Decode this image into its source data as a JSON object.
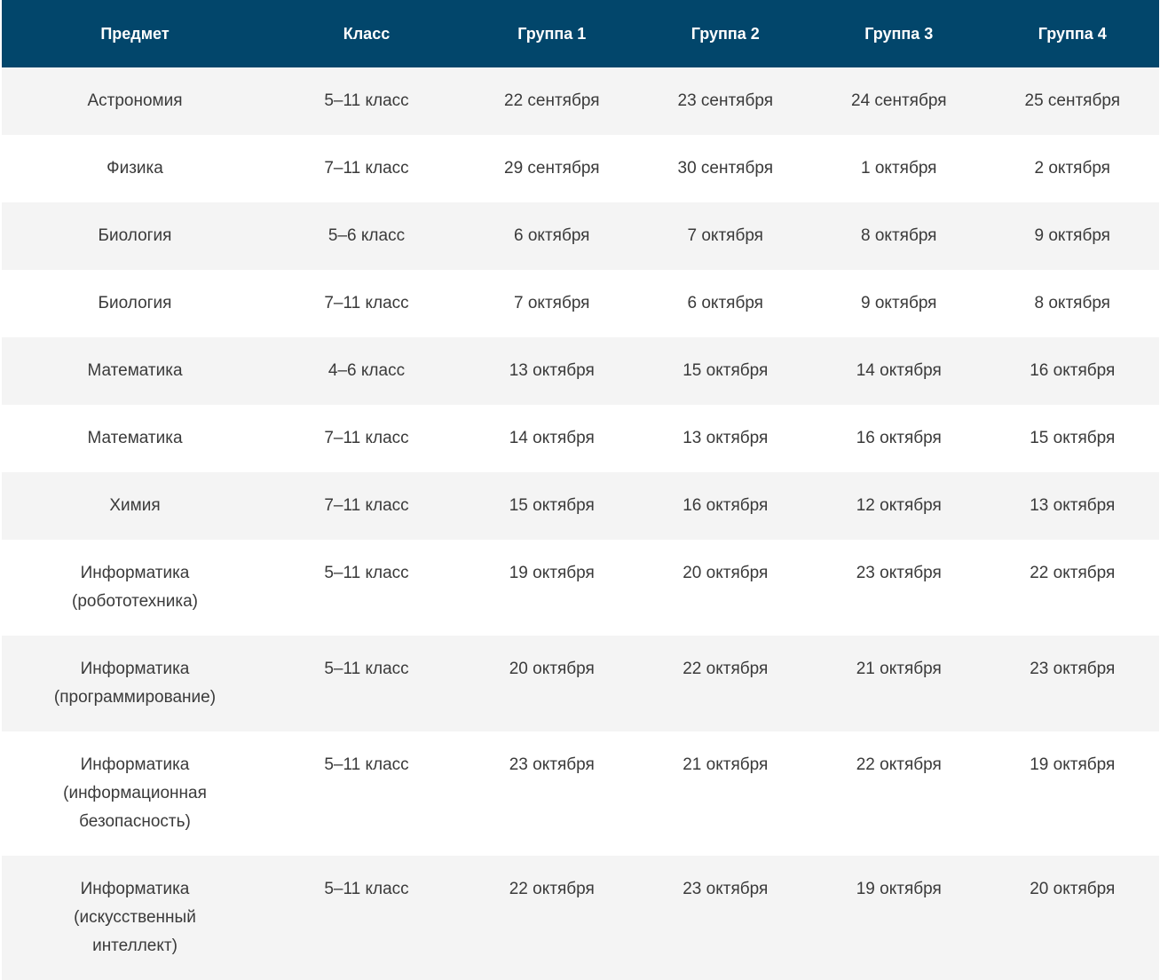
{
  "table": {
    "headers": [
      "Предмет",
      "Класс",
      "Группа 1",
      "Группа 2",
      "Группа 3",
      "Группа 4"
    ],
    "rows": [
      {
        "subject": [
          "Астрономия"
        ],
        "grade": "5–11 класс",
        "groups": [
          "22 сентября",
          "23 сентября",
          "24 сентября",
          "25 сентября"
        ]
      },
      {
        "subject": [
          "Физика"
        ],
        "grade": "7–11 класс",
        "groups": [
          "29 сентября",
          "30 сентября",
          "1 октября",
          "2 октября"
        ]
      },
      {
        "subject": [
          "Биология"
        ],
        "grade": "5–6 класс",
        "groups": [
          "6 октября",
          "7 октября",
          "8 октября",
          "9 октября"
        ]
      },
      {
        "subject": [
          "Биология"
        ],
        "grade": "7–11 класс",
        "groups": [
          "7 октября",
          "6 октября",
          "9 октября",
          "8 октября"
        ]
      },
      {
        "subject": [
          "Математика"
        ],
        "grade": "4–6 класс",
        "groups": [
          "13 октября",
          "15 октября",
          "14 октября",
          "16 октября"
        ]
      },
      {
        "subject": [
          "Математика"
        ],
        "grade": "7–11 класс",
        "groups": [
          "14 октября",
          "13 октября",
          "16 октября",
          "15 октября"
        ]
      },
      {
        "subject": [
          "Химия"
        ],
        "grade": "7–11 класс",
        "groups": [
          "15 октября",
          "16 октября",
          "12 октября",
          "13 октября"
        ]
      },
      {
        "subject": [
          "Информатика",
          "(робототехника)"
        ],
        "grade": "5–11 класс",
        "groups": [
          "19 октября",
          "20 октября",
          "23 октября",
          "22 октября"
        ]
      },
      {
        "subject": [
          "Информатика",
          "(программирование)"
        ],
        "grade": "5–11 класс",
        "groups": [
          "20 октября",
          "22 октября",
          "21 октября",
          "23 октября"
        ]
      },
      {
        "subject": [
          "Информатика",
          "(информационная",
          "безопасность)"
        ],
        "grade": "5–11 класс",
        "groups": [
          "23 октября",
          "21 октября",
          "22 октября",
          "19 октября"
        ]
      },
      {
        "subject": [
          "Информатика",
          "(искусственный",
          "интеллект)"
        ],
        "grade": "5–11 класс",
        "groups": [
          "22 октября",
          "23 октября",
          "19 октября",
          "20 октября"
        ]
      }
    ]
  },
  "colors": {
    "header_bg": "#02466b",
    "row_alt_bg": "#f4f4f4",
    "text": "#3a3a3a"
  }
}
